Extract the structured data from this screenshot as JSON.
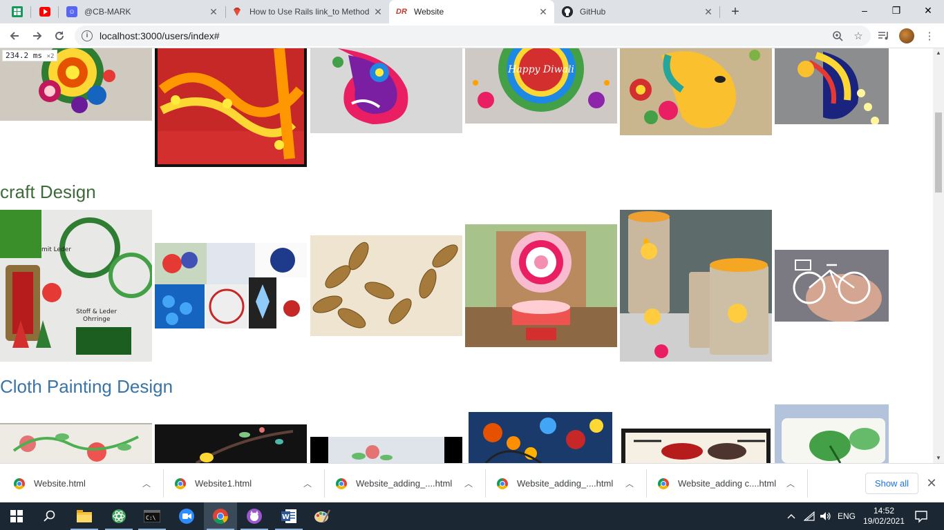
{
  "browser": {
    "tabs": [
      {
        "label": "@CB-MARK",
        "icon": "discord-icon",
        "active": false
      },
      {
        "label": "How to Use Rails link_to Method",
        "icon": "ruby-icon",
        "active": false
      },
      {
        "label": "Website",
        "icon": "rails-icon",
        "active": true
      },
      {
        "label": "GitHub",
        "icon": "github-icon",
        "active": false
      }
    ],
    "url": "localhost:3000/users/index#",
    "window_controls": {
      "minimize": "–",
      "maximize": "❐",
      "close": "✕"
    }
  },
  "fps_meter": {
    "value": "234.2 ms",
    "multiplier": "×2"
  },
  "page": {
    "sections": [
      {
        "title": "craft Design",
        "color": "#3d6b3a"
      },
      {
        "title": "Cloth Painting Design",
        "color": "#3a73a8"
      }
    ]
  },
  "downloads": {
    "items": [
      {
        "name": "Website.html"
      },
      {
        "name": "Website1.html"
      },
      {
        "name": "Website_adding_....html"
      },
      {
        "name": "Website_adding_....html"
      },
      {
        "name": "Website_adding c....html"
      }
    ],
    "show_all_label": "Show all"
  },
  "taskbar": {
    "language": "ENG",
    "time": "14:52",
    "date": "19/02/2021"
  }
}
